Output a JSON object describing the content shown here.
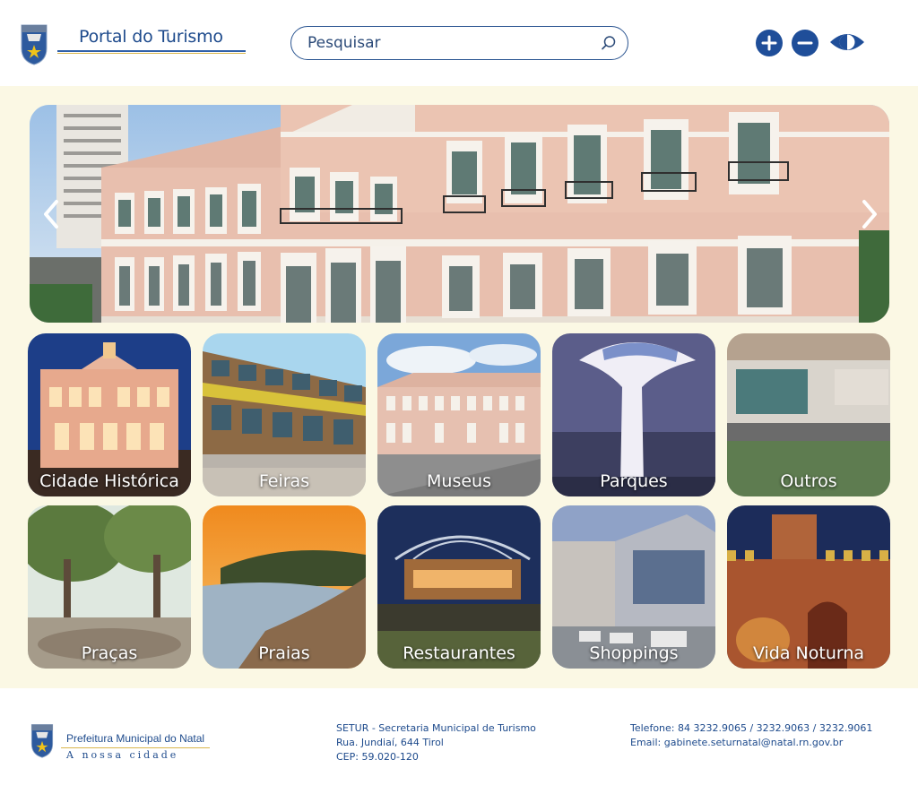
{
  "header": {
    "brand_title": "Portal do Turismo",
    "search": {
      "placeholder": "Pesquisar"
    },
    "accessibility": [
      {
        "name": "increase-font",
        "icon": "plus-icon"
      },
      {
        "name": "decrease-font",
        "icon": "minus-icon"
      },
      {
        "name": "contrast",
        "icon": "contrast-eye-icon"
      }
    ]
  },
  "hero": {
    "prev_icon": "chevron-left-icon",
    "next_icon": "chevron-right-icon"
  },
  "categories": [
    {
      "label": "Cidade Histórica"
    },
    {
      "label": "Feiras"
    },
    {
      "label": "Museus"
    },
    {
      "label": "Parques"
    },
    {
      "label": "Outros"
    },
    {
      "label": "Praças"
    },
    {
      "label": "Praias"
    },
    {
      "label": "Restaurantes"
    },
    {
      "label": "Shoppings"
    },
    {
      "label": "Vida Noturna"
    }
  ],
  "footer": {
    "logo_title": "Prefeitura Municipal do Natal",
    "logo_subtitle": "A nossa cidade",
    "address": {
      "line1": "SETUR - Secretaria Municipal de Turismo",
      "line2": "Rua. Jundiaí, 644 Tirol",
      "line3": "CEP: 59.020-120"
    },
    "contact": {
      "phone": "Telefone: 84 3232.9065 / 3232.9063 / 3232.9061",
      "email": "Email: gabinete.seturnatal@natal.rn.gov.br"
    }
  },
  "colors": {
    "brand_blue": "#1f4e99",
    "background_cream": "#fbf8e4",
    "accent_gold": "#d9b64b"
  }
}
